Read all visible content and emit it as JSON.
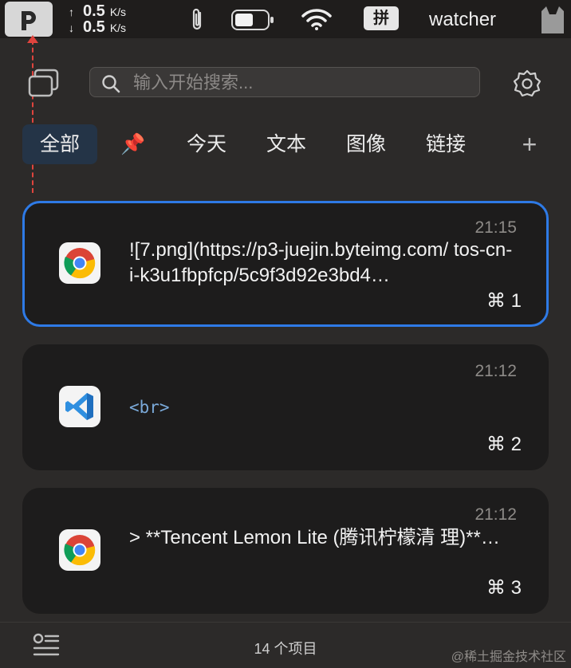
{
  "menubar": {
    "app_letter": "P",
    "net_up_value": "0.5",
    "net_up_unit": "K/s",
    "net_down_value": "0.5",
    "net_down_unit": "K/s",
    "up_arrow": "↑",
    "down_arrow": "↓",
    "input_method": "拼",
    "username": "watcher",
    "icons": [
      "paperclip-icon",
      "battery-icon",
      "wifi-icon",
      "cat-icon"
    ]
  },
  "search": {
    "placeholder": "输入开始搜索..."
  },
  "tabs": [
    {
      "label": "全部",
      "active": true
    },
    {
      "label": "📌",
      "active": false
    },
    {
      "label": "今天",
      "active": false
    },
    {
      "label": "文本",
      "active": false
    },
    {
      "label": "图像",
      "active": false
    },
    {
      "label": "链接",
      "active": false
    },
    {
      "label": "+",
      "active": false
    }
  ],
  "items": [
    {
      "time": "21:15",
      "app": "chrome-icon",
      "content": "![7.png](https://p3-juejin.byteimg.com/ tos-cn-i-k3u1fbpfcp/5c9f3d92e3bd4…",
      "shortcut": "⌘ 1",
      "selected": true
    },
    {
      "time": "21:12",
      "app": "vscode-icon",
      "content": "<br>",
      "shortcut": "⌘ 2",
      "selected": false
    },
    {
      "time": "21:12",
      "app": "chrome-icon",
      "content": "> **Tencent Lemon Lite (腾讯柠檬清 理)**…",
      "shortcut": "⌘ 3",
      "selected": false
    }
  ],
  "footer": {
    "count": "14 个项目",
    "watermark": "@稀土掘金技术社区"
  },
  "colors": {
    "accent": "#2e7ae6",
    "active_tab_bg": "#243447",
    "card_bg": "#1d1c1c",
    "annotation_red": "#e0443e"
  }
}
